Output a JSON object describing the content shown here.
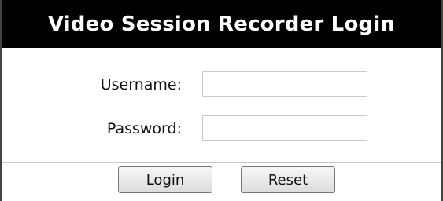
{
  "window": {
    "title": "Video Session Recorder Login"
  },
  "form": {
    "username_label": "Username:",
    "username_value": "",
    "password_label": "Password:",
    "password_value": ""
  },
  "buttons": {
    "login_label": "Login",
    "reset_label": "Reset"
  },
  "colors": {
    "title_background": "#000000",
    "title_text": "#ffffff",
    "border": "#444444",
    "divider": "#c9c9c9"
  }
}
